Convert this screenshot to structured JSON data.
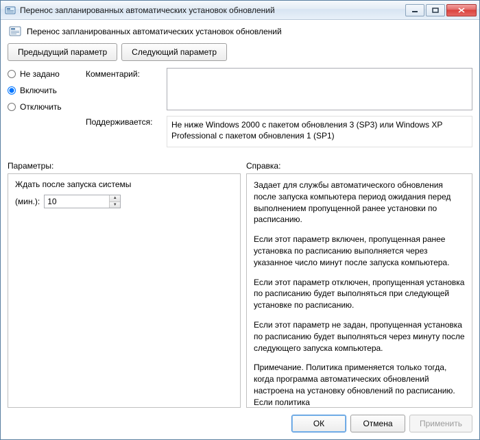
{
  "window": {
    "title": "Перенос запланированных автоматических установок обновлений"
  },
  "header": {
    "title": "Перенос запланированных автоматических установок обновлений"
  },
  "nav": {
    "prev": "Предыдущий параметр",
    "next": "Следующий параметр"
  },
  "state": {
    "not_configured": "Не задано",
    "enabled": "Включить",
    "disabled": "Отключить",
    "selected": "enabled"
  },
  "fields": {
    "comment_label": "Комментарий:",
    "comment_value": "",
    "supported_label": "Поддерживается:",
    "supported_value": "Не ниже Windows 2000 с пакетом обновления 3 (SP3) или Windows XP Professional с пакетом обновления 1 (SP1)"
  },
  "section_labels": {
    "options": "Параметры:",
    "help": "Справка:"
  },
  "options": {
    "wait_label": "Ждать после запуска системы",
    "minutes_label": "(мин.):",
    "minutes_value": "10"
  },
  "help": {
    "p1": "Задает для службы автоматического обновления после запуска компьютера период ожидания перед выполнением пропущенной ранее установки по расписанию.",
    "p2": "Если этот параметр включен, пропущенная ранее установка по расписанию выполняется через указанное число минут после запуска компьютера.",
    "p3": "Если этот параметр отключен, пропущенная установка по расписанию будет выполняться при следующей установке по расписанию.",
    "p4": "Если этот параметр не задан, пропущенная установка по расписанию будет выполняться через минуту после следующего запуска компьютера.",
    "p5": "Примечание. Политика применяется только тогда, когда программа автоматических обновлений настроена на установку обновлений по расписанию. Если политика"
  },
  "footer": {
    "ok": "ОК",
    "cancel": "Отмена",
    "apply": "Применить"
  }
}
